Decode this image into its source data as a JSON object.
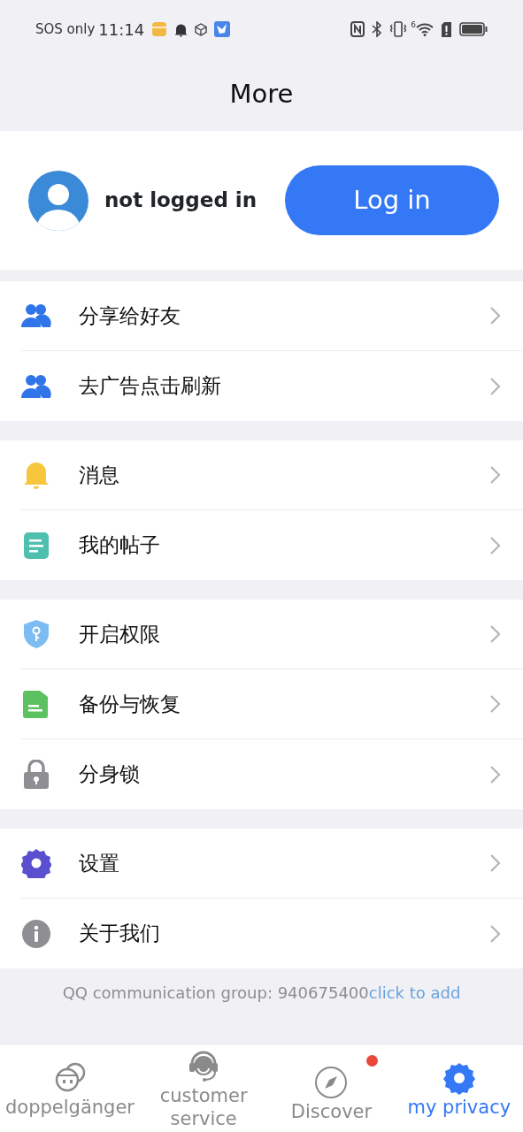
{
  "status_bar": {
    "carrier": "SOS only",
    "time": "11:14",
    "wifi_label": "6"
  },
  "header": {
    "title": "More"
  },
  "profile": {
    "name": "not logged in",
    "login_button": "Log in"
  },
  "groups": [
    {
      "items": [
        {
          "label": "分享给好友",
          "kind": "people"
        },
        {
          "label": "去广告点击刷新",
          "kind": "people"
        }
      ]
    },
    {
      "items": [
        {
          "label": "消息",
          "kind": "bell"
        },
        {
          "label": "我的帖子",
          "kind": "note"
        }
      ]
    },
    {
      "items": [
        {
          "label": "开启权限",
          "kind": "shield"
        },
        {
          "label": "备份与恢复",
          "kind": "folder"
        },
        {
          "label": "分身锁",
          "kind": "lock"
        }
      ]
    },
    {
      "items": [
        {
          "label": "设置",
          "kind": "gear"
        },
        {
          "label": "关于我们",
          "kind": "info"
        }
      ]
    }
  ],
  "footer": {
    "text": "QQ communication group: 940675400",
    "link": "click to add"
  },
  "bottom_nav": [
    {
      "label": "doppelgänger",
      "kind": "faces",
      "selected": false,
      "badge": false
    },
    {
      "label": "customer service",
      "kind": "headset",
      "selected": false,
      "badge": false
    },
    {
      "label": "Discover",
      "kind": "compass",
      "selected": false,
      "badge": true
    },
    {
      "label": "my privacy",
      "kind": "gear",
      "selected": true,
      "badge": false
    }
  ]
}
